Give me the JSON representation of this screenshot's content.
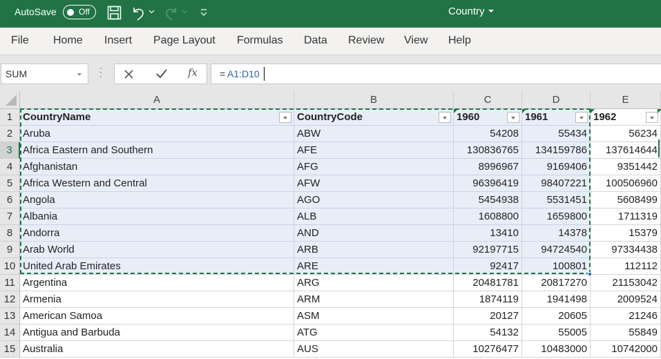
{
  "titlebar": {
    "autosave_label": "AutoSave",
    "autosave_state": "Off",
    "document_title": "Country",
    "icons": [
      "save-icon",
      "undo-icon",
      "redo-icon",
      "customize-toolbar-icon"
    ]
  },
  "menu": {
    "items": [
      "File",
      "Home",
      "Insert",
      "Page Layout",
      "Formulas",
      "Data",
      "Review",
      "View",
      "Help"
    ]
  },
  "formula_bar": {
    "name_box": "SUM",
    "cancel_icon": "close-icon",
    "enter_icon": "check-icon",
    "function_icon": "fx",
    "formula_prefix": "=",
    "formula_ref": "A1:D10"
  },
  "sheet": {
    "columns": [
      "A",
      "B",
      "C",
      "D",
      "E"
    ],
    "header_row": [
      "CountryName",
      "CountryCode",
      "1960",
      "1961",
      "1962"
    ],
    "rows": [
      {
        "num": "2",
        "name": "Aruba",
        "code": "ABW",
        "y1960": "54208",
        "y1961": "55434",
        "y1962": "56234"
      },
      {
        "num": "3",
        "name": "Africa Eastern and Southern",
        "code": "AFE",
        "y1960": "130836765",
        "y1961": "134159786",
        "y1962": "137614644"
      },
      {
        "num": "4",
        "name": "Afghanistan",
        "code": "AFG",
        "y1960": "8996967",
        "y1961": "9169406",
        "y1962": "9351442"
      },
      {
        "num": "5",
        "name": "Africa Western and Central",
        "code": "AFW",
        "y1960": "96396419",
        "y1961": "98407221",
        "y1962": "100506960"
      },
      {
        "num": "6",
        "name": "Angola",
        "code": "AGO",
        "y1960": "5454938",
        "y1961": "5531451",
        "y1962": "5608499"
      },
      {
        "num": "7",
        "name": "Albania",
        "code": "ALB",
        "y1960": "1608800",
        "y1961": "1659800",
        "y1962": "1711319"
      },
      {
        "num": "8",
        "name": "Andorra",
        "code": "AND",
        "y1960": "13410",
        "y1961": "14378",
        "y1962": "15379"
      },
      {
        "num": "9",
        "name": "Arab World",
        "code": "ARB",
        "y1960": "92197715",
        "y1961": "94724540",
        "y1962": "97334438"
      },
      {
        "num": "10",
        "name": "United Arab Emirates",
        "code": "ARE",
        "y1960": "92417",
        "y1961": "100801",
        "y1962": "112112"
      },
      {
        "num": "11",
        "name": "Argentina",
        "code": "ARG",
        "y1960": "20481781",
        "y1961": "20817270",
        "y1962": "21153042"
      },
      {
        "num": "12",
        "name": "Armenia",
        "code": "ARM",
        "y1960": "1874119",
        "y1961": "1941498",
        "y1962": "2009524"
      },
      {
        "num": "13",
        "name": "American Samoa",
        "code": "ASM",
        "y1960": "20127",
        "y1961": "20605",
        "y1962": "21246"
      },
      {
        "num": "14",
        "name": "Antigua and Barbuda",
        "code": "ATG",
        "y1960": "54132",
        "y1961": "55005",
        "y1962": "55849"
      },
      {
        "num": "15",
        "name": "Australia",
        "code": "AUS",
        "y1960": "10276477",
        "y1961": "10483000",
        "y1962": "10742000"
      }
    ],
    "selected_range": "A1:D10",
    "active_row": "3"
  },
  "colors": {
    "brand_green": "#217346",
    "selection_fill": "#e8eef8",
    "formula_ref_blue": "#3061b5"
  }
}
